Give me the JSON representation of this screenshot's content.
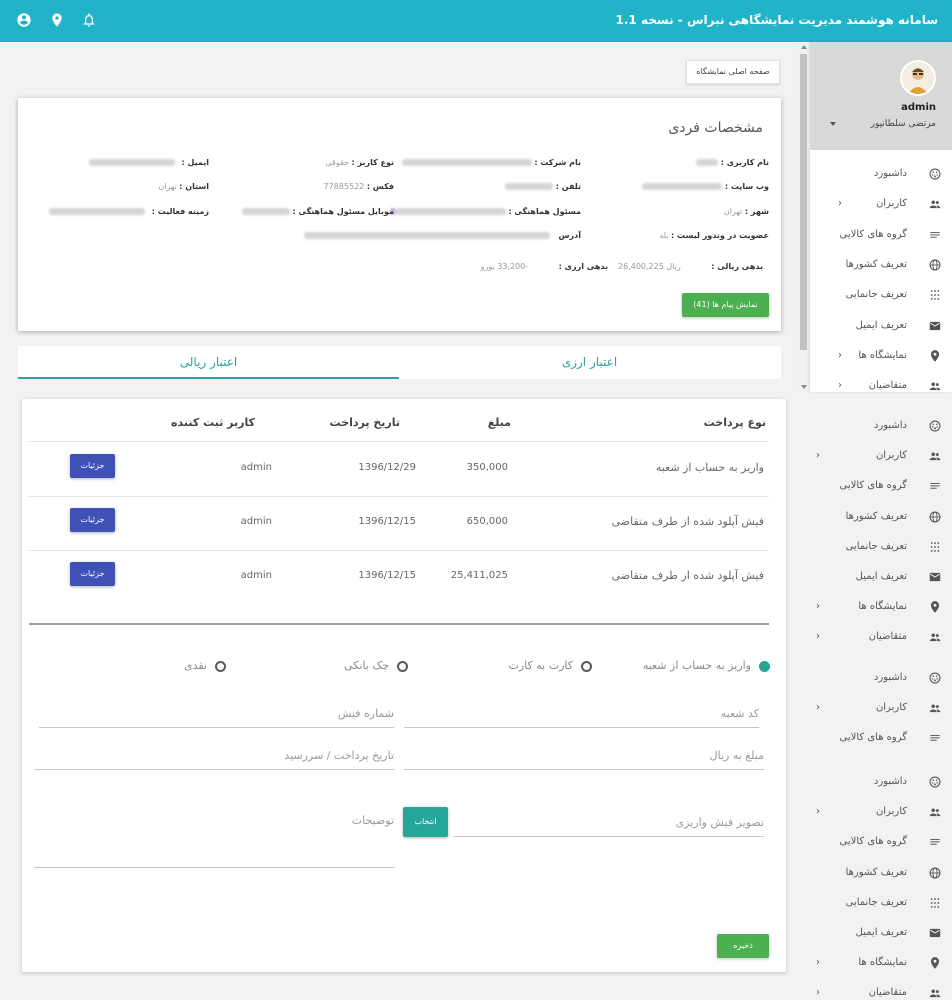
{
  "header": {
    "title": "سامانه هوشمند مدیریت نمایشگاهی نبراس - نسخه 1.1",
    "icons": [
      "account-circle-icon",
      "location-pin-icon",
      "bell-icon"
    ]
  },
  "home_button": "صفحه اصلی نمایشگاه",
  "profile": {
    "title": "مشخصات فردی",
    "fields": {
      "username_label": "نام کاربری :",
      "company_label": "نام شرکت :",
      "user_type_label": "نوع کاربر :",
      "user_type_value": "حقوقی",
      "email_label": "ایمیل :",
      "website_label": "وب سایت :",
      "phone_label": "تلفن :",
      "fax_label": "فکس :",
      "fax_value": "77885522",
      "province_label": "استان :",
      "province_value": "تهران",
      "city_label": "شهر :",
      "city_value": "تهران",
      "coordinator_label": "مسئول هماهنگی :",
      "coordinator_mobile_label": "موبایل مسئول هماهنگی :",
      "activity_label": "زمینه فعالیت :",
      "vendor_list_label": "عضویت در وندور لیست :",
      "vendor_list_value": "بله",
      "address_label": "آدرس",
      "rial_debt_label": "بدهی ریالی :",
      "rial_debt_value": "26,400,225",
      "rial_unit": "ریال",
      "currency_debt_label": "بدهی ارزی :",
      "currency_debt_value": "-33,200",
      "currency_unit": "یورو"
    },
    "messages_button": "نمایش پیام ها (41)"
  },
  "tabs": [
    {
      "label": "اعتبار ارزی",
      "active": false
    },
    {
      "label": "اعتبار ریالی",
      "active": true
    }
  ],
  "table": {
    "headers": {
      "type": "نوع پرداخت",
      "amount": "مبلغ",
      "date": "تاریخ پرداخت",
      "user": "کاربر ثبت کننده"
    },
    "details_label": "جزئیات",
    "rows": [
      {
        "type": "واریز به حساب از شعبه",
        "amount": "350,000",
        "date": "1396/12/29",
        "user": "admin"
      },
      {
        "type": "فیش آپلود شده از طرف متقاضی",
        "amount": "650,000",
        "date": "1396/12/15",
        "user": "admin"
      },
      {
        "type": "فیش آپلود شده از طرف متقاضی",
        "amount": "25,411,025",
        "date": "1396/12/15",
        "user": "admin"
      }
    ]
  },
  "form": {
    "payment_options": [
      {
        "label": "واریز به حساب از شعبه",
        "checked": true
      },
      {
        "label": "کارت به کارت",
        "checked": false
      },
      {
        "label": "چک بانکی",
        "checked": false
      },
      {
        "label": "نقدی",
        "checked": false
      }
    ],
    "branch_code_placeholder": "کد شعبه",
    "receipt_number_placeholder": "شماره فیش",
    "amount_placeholder": "مبلغ به ریال",
    "date_placeholder": "تاریخ پرداخت / سررسید",
    "receipt_image_placeholder": "تصویر فیش واریزی",
    "choose_button": "انتخاب",
    "description_placeholder": "توضیحات",
    "save_button": "ذخیره"
  },
  "sidebar": {
    "username": "admin",
    "full_name": "مرتضی سلطانپور",
    "items": [
      {
        "label": "داشبورد",
        "icon": "dashboard-icon"
      },
      {
        "label": "کاربران",
        "icon": "users-icon",
        "has_children": true
      },
      {
        "label": "گروه های کالایی",
        "icon": "list-icon"
      },
      {
        "label": "تعریف کشورها",
        "icon": "globe-icon"
      },
      {
        "label": "تعریف جانمایی",
        "icon": "grid-dots-icon"
      },
      {
        "label": "تعریف ایمیل",
        "icon": "email-icon"
      },
      {
        "label": "نمایشگاه ها",
        "icon": "location-pin-icon",
        "has_children": true
      },
      {
        "label": "متقاضیان",
        "icon": "users-icon",
        "has_children": true
      }
    ]
  },
  "colors": {
    "header": "#21b3c7",
    "accent_teal": "#26a69a",
    "green_button": "#4caf50",
    "indigo_button": "#3f51b5"
  }
}
